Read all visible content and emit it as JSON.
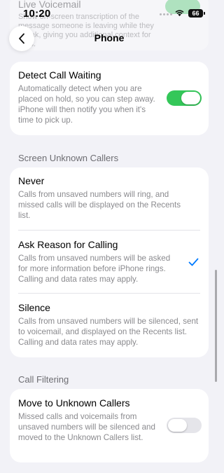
{
  "status_bar": {
    "time": "10:20",
    "battery": "66"
  },
  "background_row": {
    "title": "Live Voicemail",
    "description": "Show on-screen transcription of the message someone is leaving while they speak, giving you additional context for calls."
  },
  "nav": {
    "title": "Phone",
    "back_icon": "chevron-left-icon"
  },
  "call_waiting": {
    "title": "Detect Call Waiting",
    "description": "Automatically detect when you are placed on hold, so you can step away. iPhone will then notify you when it's time to pick up.",
    "enabled": true
  },
  "screen_unknown": {
    "header": "Screen Unknown Callers",
    "options": [
      {
        "title": "Never",
        "description": "Calls from unsaved numbers will ring, and missed calls will be displayed on the Recents list.",
        "selected": false
      },
      {
        "title": "Ask Reason for Calling",
        "description": "Calls from unsaved numbers will be asked for more information before iPhone rings. Calling and data rates may apply.",
        "selected": true
      },
      {
        "title": "Silence",
        "description": "Calls from unsaved numbers will be silenced, sent to voicemail, and displayed on the Recents list. Calling and data rates may apply.",
        "selected": false
      }
    ]
  },
  "call_filtering": {
    "header": "Call Filtering",
    "title": "Move to Unknown Callers",
    "description": "Missed calls and voicemails from unsaved numbers will be silenced and moved to the Unknown Callers list.",
    "enabled": false
  },
  "colors": {
    "accent": "#007aff",
    "toggle_on": "#34c759",
    "toggle_off": "#e5e5ea",
    "background": "#f2f2f7"
  }
}
